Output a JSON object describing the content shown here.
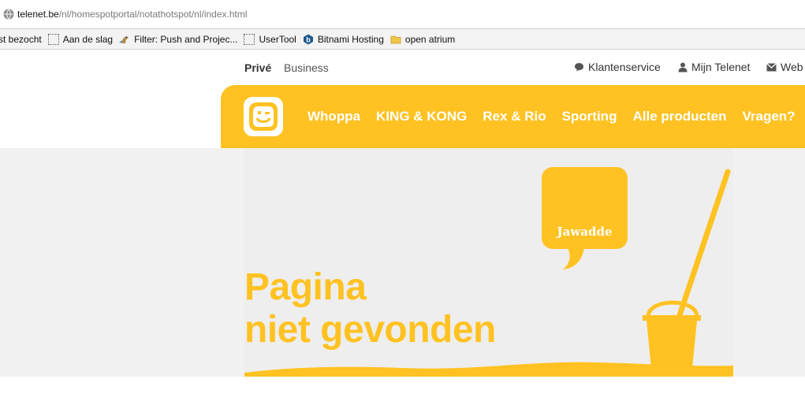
{
  "browser": {
    "url_host": "telenet.be",
    "url_path": "/nl/homespotportal/notathotspot/nl/index.html",
    "bookmarks": [
      {
        "label": "st bezocht",
        "icon": "none"
      },
      {
        "label": "Aan de slag",
        "icon": "dotted-page-icon"
      },
      {
        "label": "Filter: Push and Projec...",
        "icon": "bird-icon"
      },
      {
        "label": "UserTool",
        "icon": "dotted-page-icon"
      },
      {
        "label": "Bitnami Hosting",
        "icon": "bitnami-icon"
      },
      {
        "label": "open atrium",
        "icon": "folder-icon"
      }
    ]
  },
  "topnav": {
    "segments": {
      "prive": "Privé",
      "business": "Business"
    },
    "util": {
      "klantenservice": "Klantenservice",
      "mijn_telenet": "Mijn Telenet",
      "webmail": "Web"
    }
  },
  "mainnav": {
    "links": [
      "Whoppa",
      "KING & KONG",
      "Rex & Rio",
      "Sporting",
      "Alle producten",
      "Vragen?"
    ]
  },
  "hero": {
    "bubble_text": "Jawadde",
    "title_line1": "Pagina",
    "title_line2": "niet gevonden"
  },
  "colors": {
    "brand_yellow": "#ffc222",
    "panel_gray": "#eeeeee",
    "text_dark": "#333333"
  }
}
